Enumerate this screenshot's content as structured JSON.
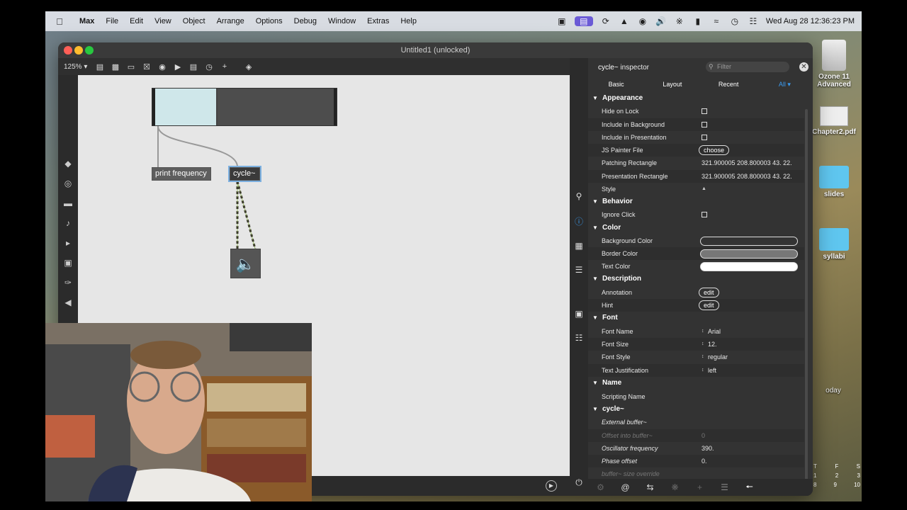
{
  "menubar": {
    "app": "Max",
    "items": [
      "File",
      "Edit",
      "View",
      "Object",
      "Arrange",
      "Options",
      "Debug",
      "Window",
      "Extras",
      "Help"
    ],
    "clock": "Wed Aug 28  12:36:23 PM"
  },
  "desktop": {
    "icons": [
      {
        "label": "Ozone 11 Advanced"
      },
      {
        "label": "Chapter2.pdf"
      },
      {
        "label": "slides"
      },
      {
        "label": "syllabi"
      }
    ],
    "calendar": {
      "days": [
        "T",
        "F",
        "S"
      ],
      "week1": [
        "1",
        "2",
        "3"
      ],
      "week2": [
        "8",
        "9",
        "10"
      ],
      "today_label": "oday"
    }
  },
  "window": {
    "title": "Untitled1 (unlocked)",
    "zoom": "125%"
  },
  "patch": {
    "print_label": "print frequency",
    "cycle_label": "cycle~"
  },
  "inspector": {
    "title_obj": "cycle~",
    "title_word": "inspector",
    "filter_placeholder": "Filter",
    "tabs": [
      "Basic",
      "Layout",
      "Recent",
      "All ▾"
    ],
    "sections": {
      "appearance": "Appearance",
      "behavior": "Behavior",
      "color": "Color",
      "description": "Description",
      "font": "Font",
      "name": "Name",
      "cycle": "cycle~"
    },
    "rows": {
      "hide_on_lock": "Hide on Lock",
      "include_bg": "Include in Background",
      "include_pres": "Include in Presentation",
      "js_painter": "JS Painter File",
      "choose": "choose",
      "patching_rect": "Patching Rectangle",
      "patching_rect_val": "321.900005 208.800003 43. 22.",
      "presentation_rect": "Presentation Rectangle",
      "presentation_rect_val": "321.900005 208.800003 43. 22.",
      "style": "Style",
      "ignore_click": "Ignore Click",
      "background_color": "Background Color",
      "border_color": "Border Color",
      "text_color": "Text Color",
      "annotation": "Annotation",
      "hint": "Hint",
      "edit": "edit",
      "font_name": "Font Name",
      "font_name_val": "Arial",
      "font_size": "Font Size",
      "font_size_val": "12.",
      "font_style": "Font Style",
      "font_style_val": "regular",
      "text_just": "Text Justification",
      "text_just_val": "left",
      "scripting_name": "Scripting Name",
      "external_buffer": "External buffer~",
      "offset_buffer": "Offset into buffer~",
      "offset_buffer_val": "0",
      "osc_freq": "Oscillator frequency",
      "osc_freq_val": "390.",
      "phase_offset": "Phase offset",
      "phase_offset_val": "0.",
      "buffer_size": "buffer~ size override"
    },
    "colors": {
      "background": "#333333",
      "border": "#777777",
      "text": "#ffffff",
      "accent": "#3a9cf2"
    }
  }
}
